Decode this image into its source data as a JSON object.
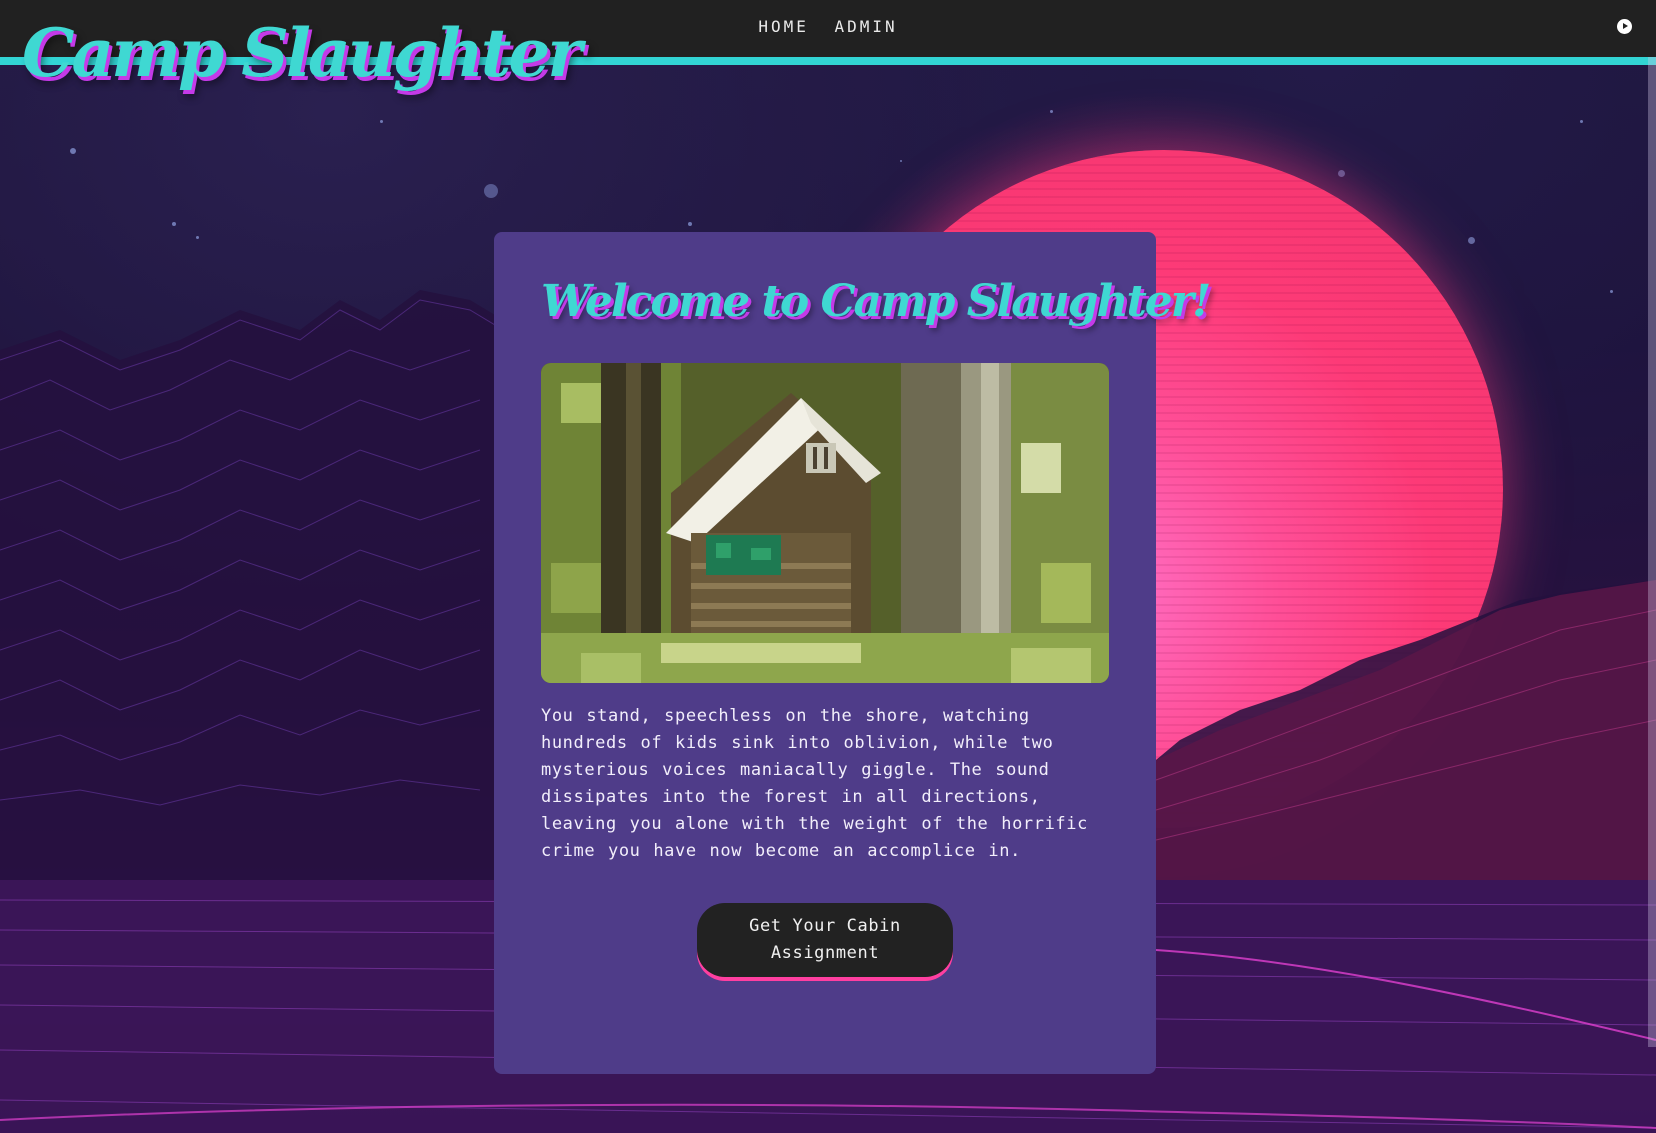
{
  "header": {
    "logo_text": "Camp Slaughter",
    "nav": [
      {
        "label": "HOME"
      },
      {
        "label": "ADMIN"
      }
    ],
    "play_icon": "play-circle-icon"
  },
  "main": {
    "title": "Welcome to Camp Slaughter!",
    "image": {
      "subject": "cabin-in-forest",
      "style": "pixel-art"
    },
    "story": "You stand, speechless on the shore, watching hundreds of kids sink into oblivion, while two mysterious voices maniacally giggle. The sound dissipates into the forest in all directions, leaving you alone with the weight of the horrific crime you have now become an accomplice in.",
    "cta_label": "Get Your Cabin Assignment"
  },
  "colors": {
    "topbar": "#212121",
    "accent_cyan": "#32d4d4",
    "logo_shadow": "#c43ae8",
    "card": "#4f3c89",
    "sun": "#fd3a77",
    "button": "#222222",
    "button_underline": "#ff3fa0"
  }
}
